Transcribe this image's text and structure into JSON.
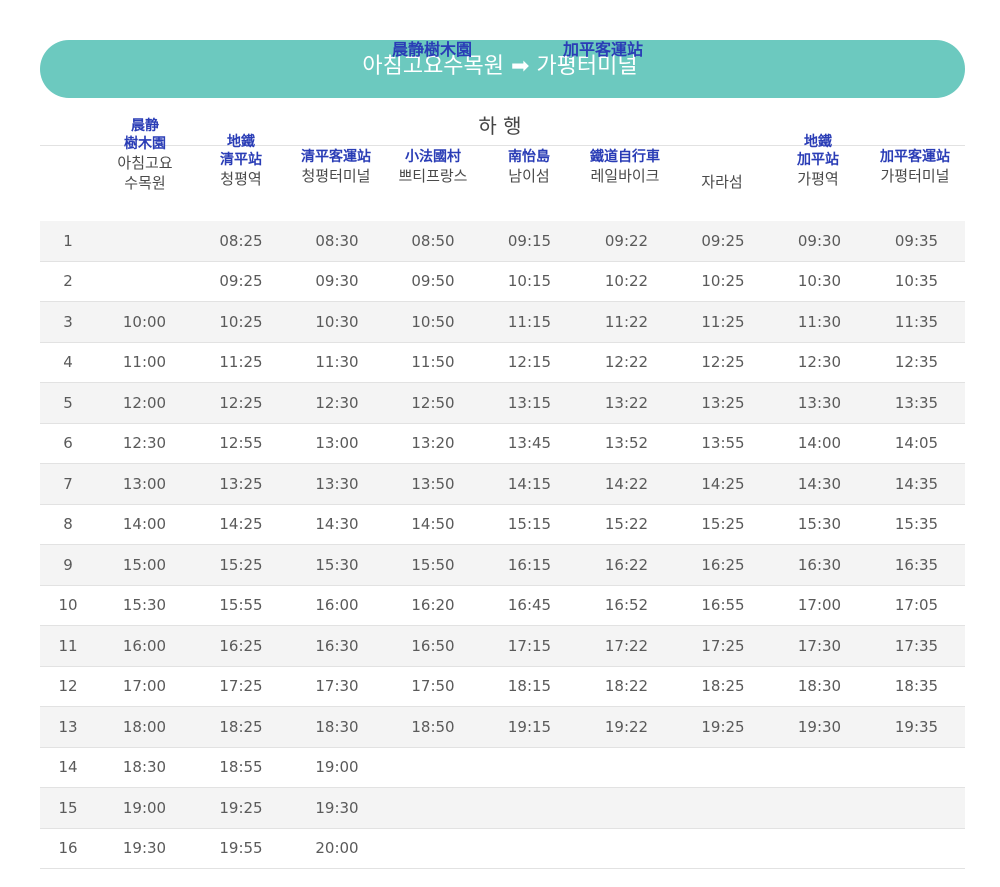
{
  "header": {
    "origin_hanja": "晨静樹木園",
    "destination_hanja": "加平客運站",
    "route_title": "아침고요수목원 ➡ 가평터미널"
  },
  "direction_label": "하 행",
  "columns": [
    {
      "hanja": "",
      "korean": ""
    },
    {
      "hanja": "晨静\n樹木園",
      "korean": "아침고요\n수목원"
    },
    {
      "hanja": "地鐵\n清平站",
      "korean": "청평역"
    },
    {
      "hanja": "清平客運站",
      "korean": "청평터미널"
    },
    {
      "hanja": "小法國村",
      "korean": "쁘티프랑스"
    },
    {
      "hanja": "南怡島",
      "korean": "남이섬"
    },
    {
      "hanja": "鐵道自行車",
      "korean": "레일바이크"
    },
    {
      "hanja": "",
      "korean": "자라섬"
    },
    {
      "hanja": "地鐵\n加平站",
      "korean": "가평역"
    },
    {
      "hanja": "加平客運站",
      "korean": "가평터미널"
    }
  ],
  "rows": [
    [
      "1",
      "",
      "08:25",
      "08:30",
      "08:50",
      "09:15",
      "09:22",
      "09:25",
      "09:30",
      "09:35"
    ],
    [
      "2",
      "",
      "09:25",
      "09:30",
      "09:50",
      "10:15",
      "10:22",
      "10:25",
      "10:30",
      "10:35"
    ],
    [
      "3",
      "10:00",
      "10:25",
      "10:30",
      "10:50",
      "11:15",
      "11:22",
      "11:25",
      "11:30",
      "11:35"
    ],
    [
      "4",
      "11:00",
      "11:25",
      "11:30",
      "11:50",
      "12:15",
      "12:22",
      "12:25",
      "12:30",
      "12:35"
    ],
    [
      "5",
      "12:00",
      "12:25",
      "12:30",
      "12:50",
      "13:15",
      "13:22",
      "13:25",
      "13:30",
      "13:35"
    ],
    [
      "6",
      "12:30",
      "12:55",
      "13:00",
      "13:20",
      "13:45",
      "13:52",
      "13:55",
      "14:00",
      "14:05"
    ],
    [
      "7",
      "13:00",
      "13:25",
      "13:30",
      "13:50",
      "14:15",
      "14:22",
      "14:25",
      "14:30",
      "14:35"
    ],
    [
      "8",
      "14:00",
      "14:25",
      "14:30",
      "14:50",
      "15:15",
      "15:22",
      "15:25",
      "15:30",
      "15:35"
    ],
    [
      "9",
      "15:00",
      "15:25",
      "15:30",
      "15:50",
      "16:15",
      "16:22",
      "16:25",
      "16:30",
      "16:35"
    ],
    [
      "10",
      "15:30",
      "15:55",
      "16:00",
      "16:20",
      "16:45",
      "16:52",
      "16:55",
      "17:00",
      "17:05"
    ],
    [
      "11",
      "16:00",
      "16:25",
      "16:30",
      "16:50",
      "17:15",
      "17:22",
      "17:25",
      "17:30",
      "17:35"
    ],
    [
      "12",
      "17:00",
      "17:25",
      "17:30",
      "17:50",
      "18:15",
      "18:22",
      "18:25",
      "18:30",
      "18:35"
    ],
    [
      "13",
      "18:00",
      "18:25",
      "18:30",
      "18:50",
      "19:15",
      "19:22",
      "19:25",
      "19:30",
      "19:35"
    ],
    [
      "14",
      "18:30",
      "18:55",
      "19:00",
      "",
      "",
      "",
      "",
      "",
      ""
    ],
    [
      "15",
      "19:00",
      "19:25",
      "19:30",
      "",
      "",
      "",
      "",
      "",
      ""
    ],
    [
      "16",
      "19:30",
      "19:55",
      "20:00",
      "",
      "",
      "",
      "",
      "",
      ""
    ]
  ],
  "colors": {
    "banner": "#6cc9bf",
    "hanja_text": "#2a3db6",
    "row_stripe": "#f4f4f4"
  }
}
